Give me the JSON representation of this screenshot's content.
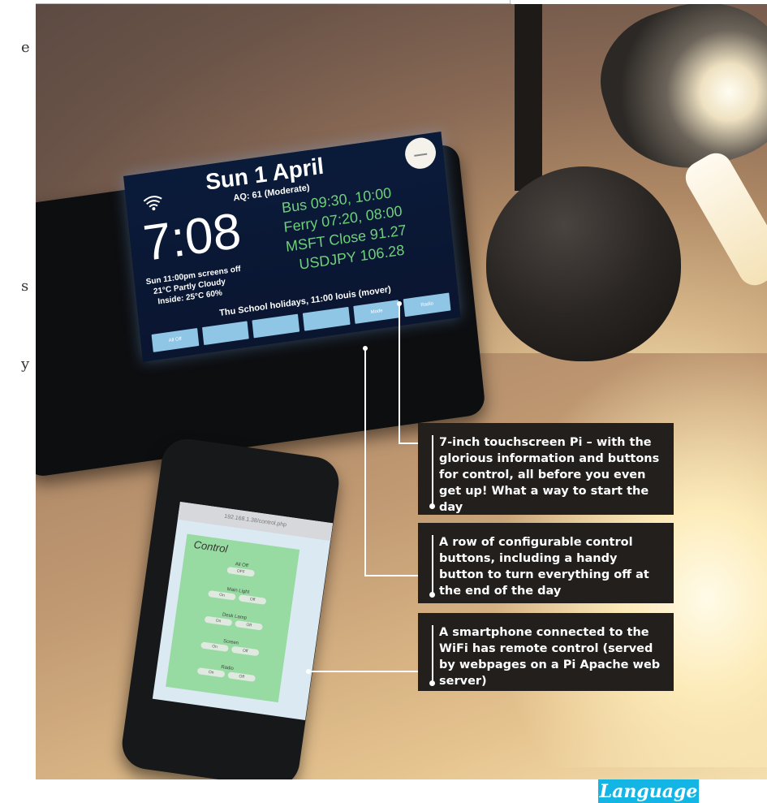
{
  "page": {
    "left_column_fragments": [
      "e",
      "s",
      "y"
    ]
  },
  "screen": {
    "date": "Sun 1 April",
    "aq": "AQ: 61 (Moderate)",
    "clock": "7:08",
    "status_lines": [
      "Sun 11:00pm screens off",
      "21°C Partly Cloudy",
      "Inside: 25°C 60%"
    ],
    "info_lines": [
      "Bus 09:30, 10:00",
      "Ferry 07:20, 08:00",
      "MSFT Close 91.27",
      "USDJPY 106.28"
    ],
    "note": "Thu School holidays,  11:00 louis (mover)",
    "buttons": [
      "All Off",
      "",
      "",
      "",
      "Mode",
      "Radio"
    ]
  },
  "phone": {
    "url": "192.168.1.38/control.php",
    "panel_title": "Control",
    "controls": [
      {
        "label": "All Off",
        "pills": [
          "OFF"
        ]
      },
      {
        "label": "Main Light",
        "pills": [
          "On",
          "Off"
        ]
      },
      {
        "label": "Desk Lamp",
        "pills": [
          "On",
          "Off"
        ]
      },
      {
        "label": "Screen",
        "pills": [
          "On",
          "Off"
        ]
      },
      {
        "label": "Radio",
        "pills": [
          "On",
          "Off"
        ]
      }
    ]
  },
  "callouts": [
    {
      "text": "7-inch touchscreen Pi – with the glorious information and buttons for control, all before you even get up! What a way to start the day"
    },
    {
      "text": "A row of configurable control buttons, including a handy button to turn everything off at the end of the day"
    },
    {
      "text": "A smartphone connected to the WiFi has remote control (served by webpages on a Pi Apache web server)"
    }
  ],
  "badge": {
    "text": "Language"
  },
  "colors": {
    "callout_bg": "#221f1d",
    "badge": "#12b5e4",
    "screen_green": "#6fd07a"
  }
}
